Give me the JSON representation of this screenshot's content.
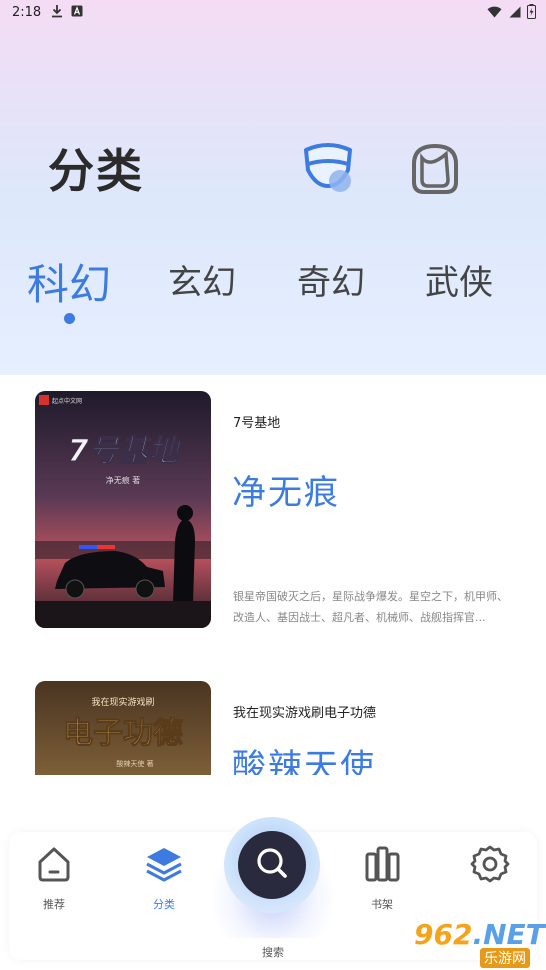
{
  "status_bar": {
    "time": "2:18",
    "icons": [
      "download-icon",
      "a-badge-icon",
      "wifi-icon",
      "signal-icon",
      "battery-charging-icon"
    ]
  },
  "header": {
    "title": "分类",
    "icons": [
      "mask-face-icon",
      "face-outline-icon"
    ]
  },
  "category_tabs": [
    {
      "label": "科幻",
      "active": true
    },
    {
      "label": "玄幻",
      "active": false
    },
    {
      "label": "奇幻",
      "active": false
    },
    {
      "label": "武侠",
      "active": false
    }
  ],
  "books": [
    {
      "name": "7号基地",
      "author": "净无痕",
      "description": "银星帝国破灭之后，星际战争爆发。星空之下，机甲师、改造人、基因战士、超凡者、机械师、战舰指挥官...",
      "cover": {
        "title": "7号基地",
        "author_line": "净无痕 著",
        "badge": "起点中文网"
      }
    },
    {
      "name": "我在现实游戏刷电子功德",
      "author": "酸辣天使",
      "description": "",
      "cover": {
        "title": "电子功德",
        "subtitle": "我在现实游戏刷",
        "author_line": "酸辣天使 著"
      }
    }
  ],
  "bottom_nav": {
    "items": [
      {
        "label": "推荐",
        "icon": "home-icon",
        "active": false
      },
      {
        "label": "分类",
        "icon": "layers-icon",
        "active": true
      },
      {
        "label": "搜索",
        "icon": "search-icon",
        "active": false
      },
      {
        "label": "书架",
        "icon": "bookshelf-icon",
        "active": false
      },
      {
        "label": "",
        "icon": "settings-gear-icon",
        "active": false
      }
    ]
  },
  "watermark": {
    "main": "962",
    "suffix": ".NET",
    "sub": "乐游网"
  },
  "colors": {
    "accent": "#3d7be0",
    "title": "#2b2b2b"
  }
}
